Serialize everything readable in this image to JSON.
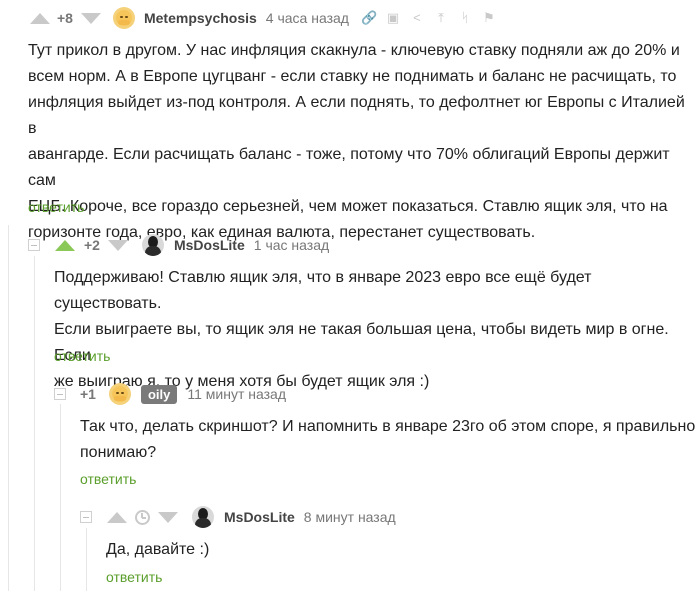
{
  "colors": {
    "reply": "#5a9e2b",
    "upvote_active": "#8ac858",
    "muted": "#c9c9c9",
    "badge": "#7a7a7a"
  },
  "comments": [
    {
      "rating": "+8",
      "user": "Metempsychosis",
      "time": "4 часа назад",
      "icons": [
        "link-icon",
        "save-icon",
        "share-icon",
        "go-to-parent-icon",
        "branch-icon",
        "report-flag-icon"
      ],
      "lines": [
        "Тут прикол в другом. У нас инфляция скакнула - ключевую ставку подняли аж до 20% и",
        "всем норм. А в Европе цугцванг - если ставку не поднимать и баланс не расчищать, то",
        "инфляция выйдет из-под контроля. А если поднять, то дефолтнет юг Европы с Италией в",
        "авангарде. Если расчищать баланс - тоже, потому что 70% облигаций Европы держит сам",
        "ЕЦБ. Короче, все гораздо серьезней, чем может показаться. Ставлю ящик эля, что на",
        "горизонте года, евро, как единая валюта, перестанет существовать."
      ],
      "reply": "ответить"
    },
    {
      "rating": "+2",
      "user": "MsDosLite",
      "time": "1 час назад",
      "lines": [
        "Поддерживаю! Ставлю ящик эля, что в январе 2023 евро все ещё будет существовать.",
        "Если выиграете вы, то ящик эля не такая большая цена, чтобы видеть мир в огне. Если",
        "же выиграю я, то у меня хотя бы будет ящик эля :)"
      ],
      "reply": "ответить"
    },
    {
      "rating": "+1",
      "user": "oily",
      "time": "11 минут назад",
      "lines": [
        "Так что, делать скриншот? И напомнить в январе 23го об этом споре, я правильно",
        "понимаю?"
      ],
      "reply": "ответить"
    },
    {
      "user": "MsDosLite",
      "time": "8 минут назад",
      "lines": [
        "Да, давайте :)"
      ],
      "reply": "ответить"
    }
  ]
}
